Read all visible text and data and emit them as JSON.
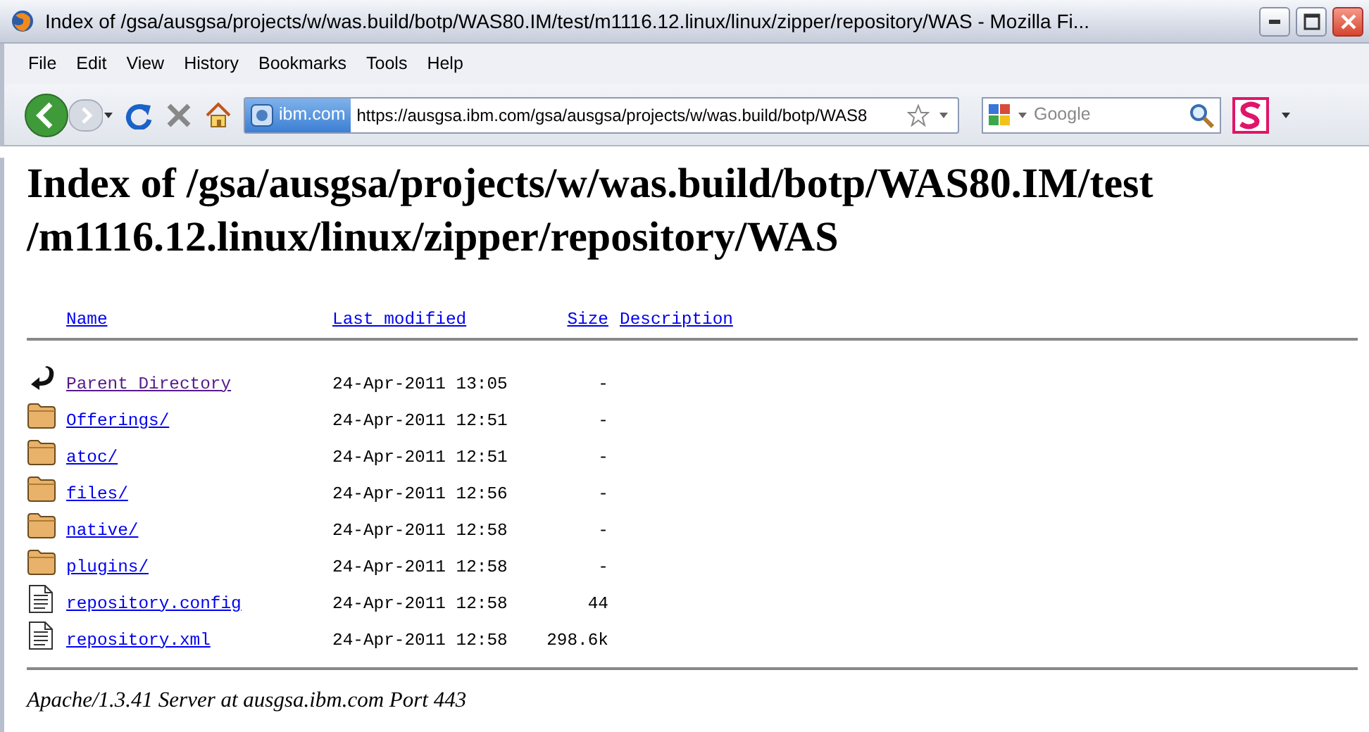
{
  "window": {
    "title": "Index of /gsa/ausgsa/projects/w/was.build/botp/WAS80.IM/test/m1116.12.linux/linux/zipper/repository/WAS - Mozilla Fi..."
  },
  "menu": [
    "File",
    "Edit",
    "View",
    "History",
    "Bookmarks",
    "Tools",
    "Help"
  ],
  "toolbar": {
    "site_identity": "ibm.com",
    "url": "https://ausgsa.ibm.com/gsa/ausgsa/projects/w/was.build/botp/WAS8",
    "search": {
      "placeholder": "Google"
    }
  },
  "page": {
    "heading": "Index of /gsa/ausgsa/projects/w/was.build/botp/WAS80.IM/test/m1116.12.linux/linux/zipper/repository/WAS",
    "columns": [
      "Name",
      "Last modified",
      "Size",
      "Description"
    ],
    "entries": [
      {
        "kind": "parent",
        "name": "Parent Directory",
        "visited": true,
        "modified": "24-Apr-2011 13:05",
        "size": "-"
      },
      {
        "kind": "folder",
        "name": "Offerings/",
        "visited": false,
        "modified": "24-Apr-2011 12:51",
        "size": "-"
      },
      {
        "kind": "folder",
        "name": "atoc/",
        "visited": false,
        "modified": "24-Apr-2011 12:51",
        "size": "-"
      },
      {
        "kind": "folder",
        "name": "files/",
        "visited": false,
        "modified": "24-Apr-2011 12:56",
        "size": "-"
      },
      {
        "kind": "folder",
        "name": "native/",
        "visited": false,
        "modified": "24-Apr-2011 12:58",
        "size": "-"
      },
      {
        "kind": "folder",
        "name": "plugins/",
        "visited": false,
        "modified": "24-Apr-2011 12:58",
        "size": "-"
      },
      {
        "kind": "file",
        "name": "repository.config",
        "visited": false,
        "modified": "24-Apr-2011 12:58",
        "size": "44"
      },
      {
        "kind": "file",
        "name": "repository.xml",
        "visited": false,
        "modified": "24-Apr-2011 12:58",
        "size": "298.6k"
      }
    ],
    "footer": "Apache/1.3.41 Server at ausgsa.ibm.com Port 443"
  }
}
